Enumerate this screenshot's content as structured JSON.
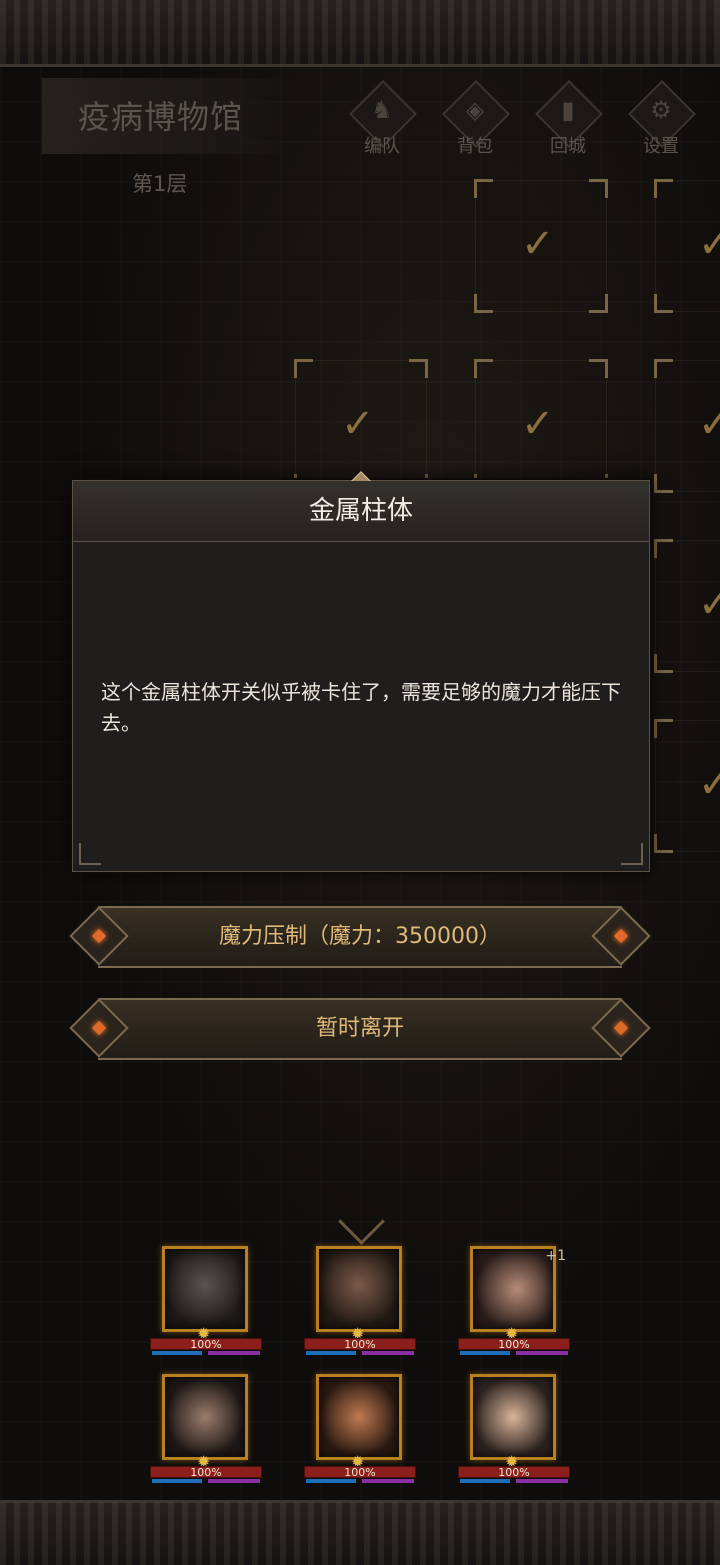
{
  "location": {
    "name": "疫病博物馆",
    "floor": "第1层"
  },
  "nav": [
    {
      "label": "编队",
      "icon": "horned-helmet-icon"
    },
    {
      "label": "背包",
      "icon": "bag-icon"
    },
    {
      "label": "回城",
      "icon": "door-icon"
    },
    {
      "label": "设置",
      "icon": "gear-icon"
    }
  ],
  "map": {
    "cleared_mark": "✓"
  },
  "dialog": {
    "title": "金属柱体",
    "body": "这个金属柱体开关似乎被卡住了，需要足够的魔力才能压下去。"
  },
  "actions": {
    "suppress": "魔力压制（魔力：350000）",
    "leave": "暂时离开"
  },
  "team": {
    "heroes": [
      {
        "hp": "100%",
        "extra": ""
      },
      {
        "hp": "100%",
        "extra": ""
      },
      {
        "hp": "100%",
        "extra": "+1"
      },
      {
        "hp": "100%",
        "extra": ""
      },
      {
        "hp": "100%",
        "extra": ""
      },
      {
        "hp": "100%",
        "extra": ""
      }
    ]
  },
  "colors": {
    "accent_gold": "#e0b979",
    "gem_orange": "#e06a2a",
    "hp_red": "#8b1f1c",
    "mana_blue": "#1f6fb8",
    "energy_purple": "#8a2fa3"
  }
}
